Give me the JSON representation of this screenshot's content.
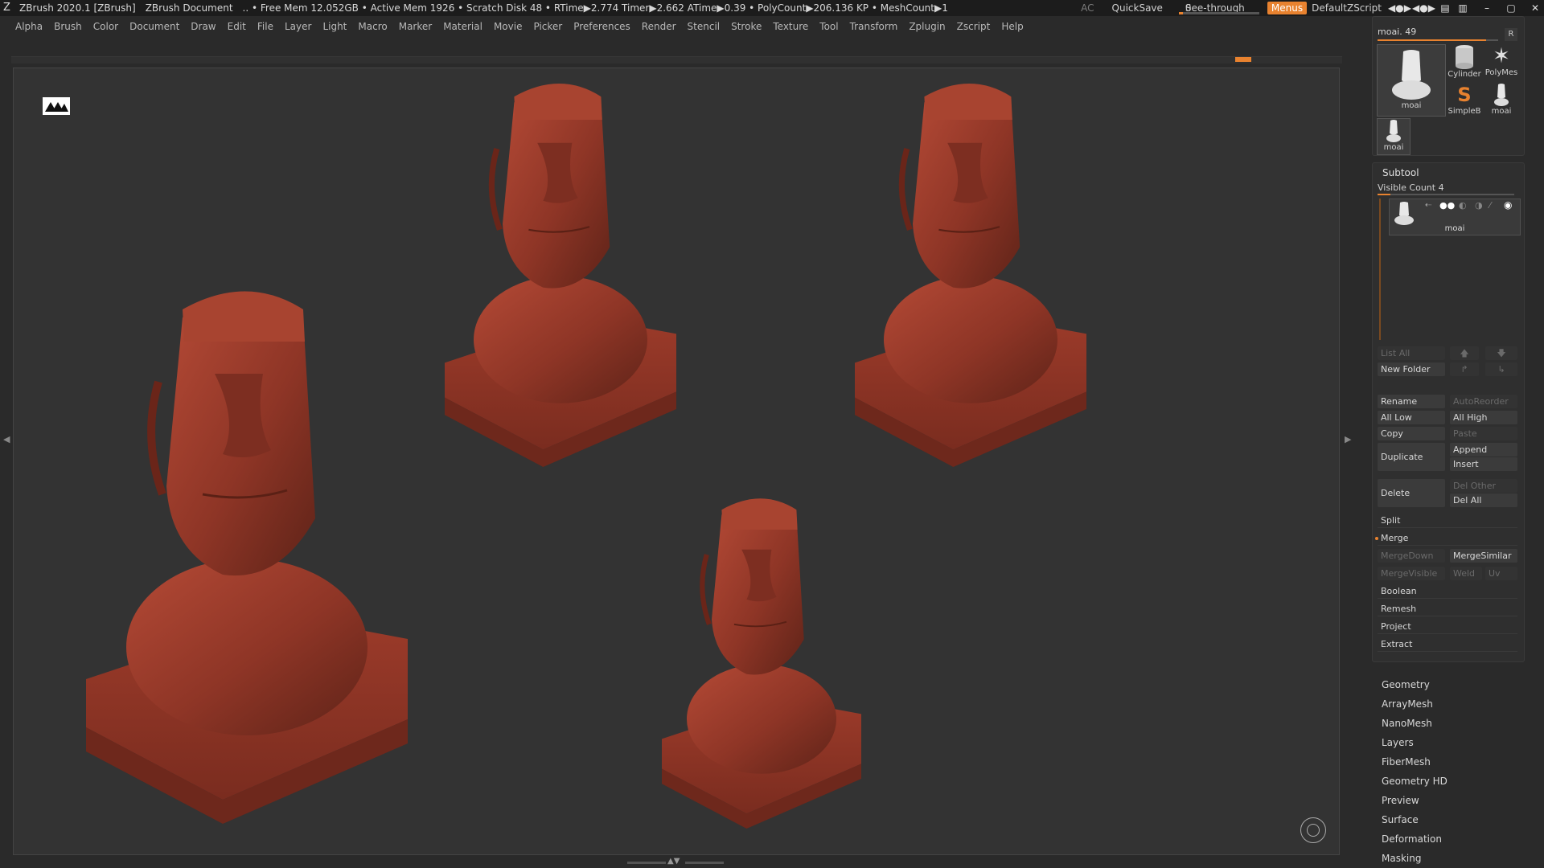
{
  "titlebar": {
    "app": "ZBrush 2020.1 [ZBrush]",
    "document": "ZBrush Document",
    "stats": ".. • Free Mem 12.052GB • Active Mem 1926 • Scratch Disk 48 •  RTime▶2.774 Timer▶2.662 ATime▶0.39 • PolyCount▶206.136 KP  • MeshCount▶1",
    "ac": "AC",
    "quicksave": "QuickSave",
    "see_through_label": "See-through",
    "see_through_value": "0",
    "see_through_level": 0.05,
    "menus": "Menus",
    "script": "DefaultZScript",
    "window_icons": [
      "◀●▶",
      "◀●▶",
      "▤",
      "▥",
      "–",
      "▢",
      "✕"
    ]
  },
  "menubar": [
    "Alpha",
    "Brush",
    "Color",
    "Document",
    "Draw",
    "Edit",
    "File",
    "Layer",
    "Light",
    "Macro",
    "Marker",
    "Material",
    "Movie",
    "Picker",
    "Preferences",
    "Render",
    "Stencil",
    "Stroke",
    "Texture",
    "Tool",
    "Transform",
    "Zplugin",
    "Zscript",
    "Help"
  ],
  "tool": {
    "name": "moai. 49",
    "slider_level": 0.9,
    "r": "R",
    "thumbs": [
      {
        "label": "moai",
        "icon": "moai-icon"
      },
      {
        "label": "Cylinder",
        "icon": "cylinder-icon"
      },
      {
        "label": "PolyMes",
        "icon": "polymesh-star-icon"
      },
      {
        "label": "SimpleB",
        "icon": "simplebrush-icon"
      },
      {
        "label": "moai",
        "icon": "moai-icon"
      },
      {
        "label": "moai",
        "icon": "moai-icon"
      }
    ]
  },
  "subtool": {
    "title": "Subtool",
    "visible_count": "Visible Count 4",
    "item_name": "moai",
    "list_all": "List All",
    "new_folder": "New Folder",
    "rename": "Rename",
    "autoreorder": "AutoReorder",
    "all_low": "All Low",
    "all_high": "All High",
    "copy": "Copy",
    "paste": "Paste",
    "duplicate": "Duplicate",
    "append": "Append",
    "insert": "Insert",
    "delete": "Delete",
    "del_other": "Del Other",
    "del_all": "Del All",
    "split": "Split",
    "merge": "Merge",
    "mergedown": "MergeDown",
    "mergesimilar": "MergeSimilar",
    "mergevisible": "MergeVisible",
    "weld": "Weld",
    "uv": "Uv",
    "boolean": "Boolean",
    "remesh": "Remesh",
    "project": "Project",
    "extract": "Extract"
  },
  "tool_sections": [
    "Geometry",
    "ArrayMesh",
    "NanoMesh",
    "Layers",
    "FiberMesh",
    "Geometry HD",
    "Preview",
    "Surface",
    "Deformation",
    "Masking"
  ],
  "colors": {
    "accent": "#e8822f",
    "clay": "#9a3a2a",
    "background": "#333333"
  }
}
